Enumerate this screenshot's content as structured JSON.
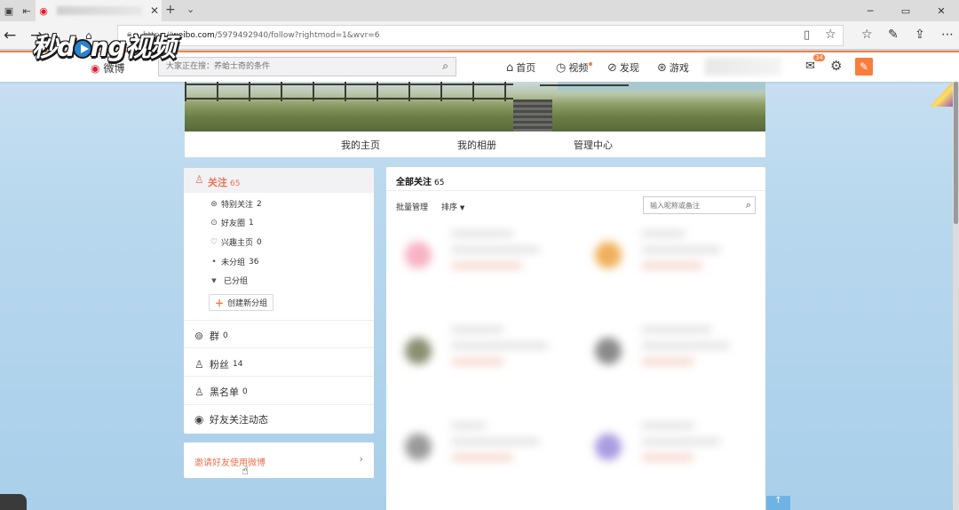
{
  "browser": {
    "url_prefix": "https://",
    "url_domain": "weibo.com",
    "url_path": "/5979492940/follow?rightmod=1&wvr=6",
    "icons": [
      "tab-list-icon",
      "back-icon",
      "forward-icon",
      "refresh-icon",
      "home-icon",
      "reader-view-icon",
      "favorite-star-icon",
      "favorites-icon",
      "pen-icon",
      "share-icon",
      "more-icon"
    ]
  },
  "watermark": {
    "text_left": "秒d",
    "text_mid": "ng",
    "text_right": "视频"
  },
  "weibo_nav": {
    "logo_text": "微博",
    "search_placeholder": "大家正在搜：养蛤士奇的条件",
    "links": [
      {
        "label": "首页",
        "icon": "home-icon"
      },
      {
        "label": "视频",
        "icon": "video-icon"
      },
      {
        "label": "发现",
        "icon": "compass-icon"
      },
      {
        "label": "游戏",
        "icon": "gamepad-icon"
      }
    ],
    "mail_badge": "34"
  },
  "cover_nav": {
    "items": [
      "我的主页",
      "我的相册",
      "管理中心"
    ]
  },
  "sidebar": {
    "follow_label": "关注",
    "follow_count": "65",
    "sub_items": [
      {
        "label": "特别关注",
        "count": "2",
        "icon": "star-circle-icon"
      },
      {
        "label": "好友圈",
        "count": "1",
        "icon": "heart-circle-icon"
      },
      {
        "label": "兴趣主页",
        "count": "0",
        "icon": "heart-icon"
      },
      {
        "label": "未分组",
        "count": "36",
        "icon": "dot-icon"
      },
      {
        "label": "已分组",
        "count": "",
        "icon": "triangle-down-icon"
      }
    ],
    "new_group_label": "创建新分组",
    "rows": [
      {
        "label": "群",
        "count": "0",
        "icon": "group-chat-icon"
      },
      {
        "label": "粉丝",
        "count": "14",
        "icon": "fans-icon"
      },
      {
        "label": "黑名单",
        "count": "0",
        "icon": "blacklist-icon"
      },
      {
        "label": "好友关注动态",
        "count": "",
        "icon": "eye-icon"
      }
    ],
    "invite_label": "邀请好友使用微博"
  },
  "main": {
    "title": "全部关注",
    "count": "65",
    "batch_label": "批量管理",
    "sort_label": "排序",
    "search_placeholder": "输入昵称或备注"
  }
}
